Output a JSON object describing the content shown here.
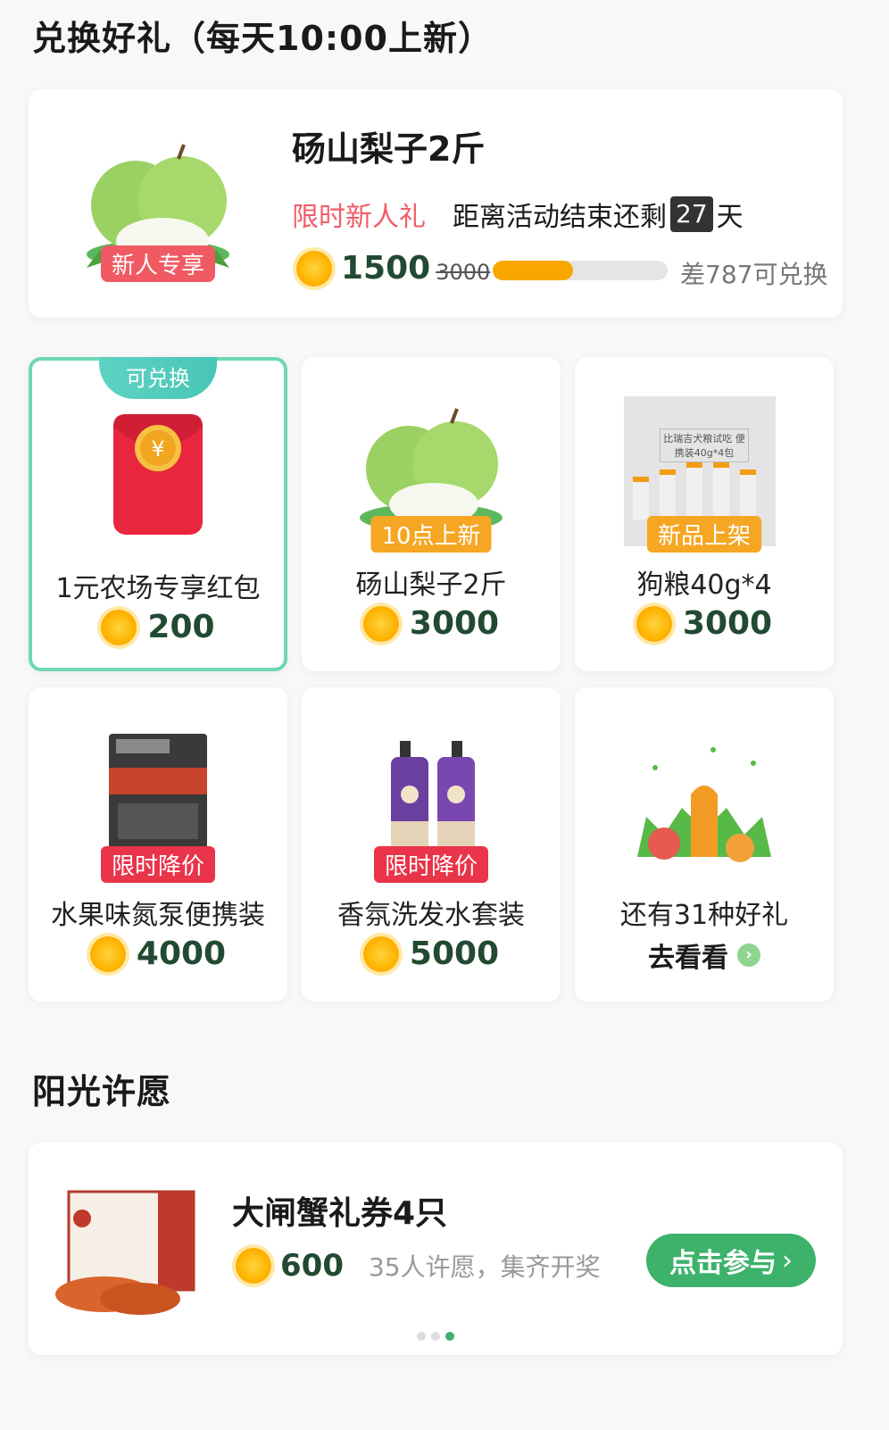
{
  "header": {
    "title": "兑换好礼（每天10:00上新）"
  },
  "featured": {
    "badge": "新人专享",
    "title": "砀山梨子2斤",
    "tag": "限时新人礼",
    "remain_prefix": "距离活动结束还剩",
    "days": "27",
    "remain_suffix": "天",
    "price": "1500",
    "original_price": "3000",
    "progress_fraction": 0.46,
    "progress_text": "差787可兑换"
  },
  "grid": [
    {
      "tab": "可兑换",
      "name": "1元农场专享红包",
      "price": "200"
    },
    {
      "badge": "10点上新",
      "name": "砀山梨子2斤",
      "price": "3000"
    },
    {
      "badge": "新品上架",
      "name": "狗粮40g*4",
      "price": "3000",
      "pack_text": "比瑞吉犬粮试吃 便携装40g*4包"
    },
    {
      "badge": "限时降价",
      "name": "水果味氮泵便携装",
      "price": "4000"
    },
    {
      "badge": "限时降价",
      "name": "香氛洗发水套装",
      "price": "5000"
    },
    {
      "name": "还有31种好礼",
      "link": "去看看"
    }
  ],
  "wish": {
    "section_title": "阳光许愿",
    "title": "大闸蟹礼券4只",
    "price": "600",
    "info": "35人许愿，集齐开奖",
    "button": "点击参与",
    "pages": 3,
    "active_page": 3
  },
  "colors": {
    "accent_green": "#3cb26b",
    "tag_red": "#f25c68",
    "progress": "#f7a700",
    "active_border": "#6fd7b4"
  }
}
